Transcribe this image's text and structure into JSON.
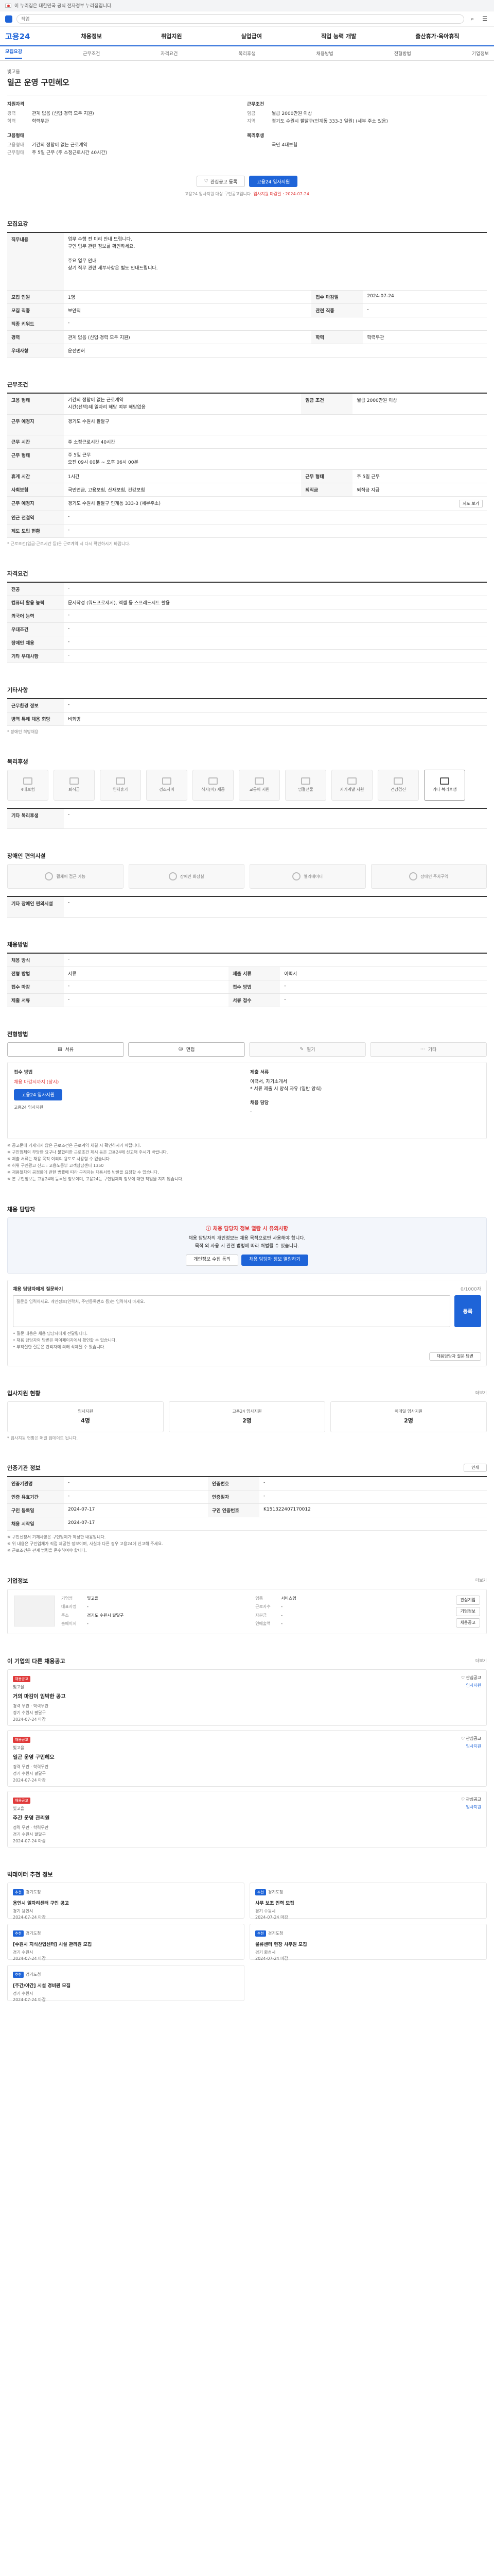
{
  "gov_bar": {
    "text": "이 누리집은 대한민국 공식 전자정부 누리집입니다."
  },
  "top": {
    "search_placeholder": "직업",
    "badge": "신규"
  },
  "header": {
    "logo": "고용24",
    "gnb": [
      "채용정보",
      "취업지원",
      "실업급여",
      "직업 능력 개발",
      "출산휴가·육아휴직"
    ]
  },
  "subtabs": [
    "모집요강",
    "근무조건",
    "자격요건",
    "복리후생",
    "채용방법",
    "전형방법",
    "기업정보"
  ],
  "job": {
    "company_line": "빛고을",
    "title": "일곤 운영 구민헤오"
  },
  "summary": {
    "qual_h": "지원자격",
    "qual": [
      {
        "k": "경력",
        "v": "관계 없음 (신입·경력 모두 지원)"
      },
      {
        "k": "학력",
        "v": "학력무관"
      }
    ],
    "cond_h": "근무조건",
    "cond": [
      {
        "k": "임금",
        "v": "월급 2000만원 이상"
      },
      {
        "k": "지역",
        "v": "경기도 수원시 팔달구(인계동 333-3 일원) (세부 주소 있음)"
      }
    ],
    "form_h": "고용형태",
    "form": [
      {
        "k": "고용형태",
        "v": "기간의 정함이 없는 근로계약"
      },
      {
        "k": "근무형태",
        "v": "주 5일 근무 (주 소정근로시간 40시간)"
      }
    ],
    "welfare_h": "복리후생",
    "welfare": [
      {
        "k": "",
        "v": "국민 4대보험"
      }
    ]
  },
  "apply": {
    "save_label": "관심공고 등록",
    "apply_label": "고용24 입사지원",
    "note": "고용24 입사지원 대상 구인공고입니다.",
    "note_red": "입사지원 마감일 : 2024-07-24"
  },
  "recruit": {
    "title": "모집요강",
    "rows": [
      {
        "k": "직무내용",
        "v": "업무 수행 전 미리 안내 드립니다.\n구인 업무 관련 정보를 확인하세요.\n\n주요 업무 안내\n상기 직무 관련 세부사항은 별도 안내드립니다."
      },
      {
        "k": "모집 인원",
        "v": "1명",
        "k2": "접수 마감일",
        "v2": "2024-07-24"
      },
      {
        "k": "모집 직종",
        "v": "보안직",
        "k2": "관련 직종",
        "v2": "-"
      },
      {
        "k": "직종 키워드",
        "v": "-",
        "k2": "",
        "v2": ""
      },
      {
        "k": "경력",
        "v": "관계 없음 (신입·경력 모두 지원)",
        "k2": "학력",
        "v2": "학력무관"
      },
      {
        "k": "우대사항",
        "v": "운전면허"
      }
    ]
  },
  "work": {
    "title": "근무조건",
    "rows": [
      {
        "k": "고용 형태",
        "v": "기간의 정함이 없는 근로계약\n시간(선택)제 일자리 해당 여부 해당없음",
        "k2": "임금 조건",
        "v2": "월급 2000만원 이상"
      },
      {
        "k": "근무 예정지",
        "v": "경기도 수원시 팔달구",
        "k2": "",
        "v2": ""
      },
      {
        "k": "근무 시간",
        "v": "주 소정근로시간 40시간",
        "k2": "",
        "v2": ""
      },
      {
        "k": "근무 형태",
        "v": "주 5일 근무\n오전 09시 00분 ~ 오후 06시 00분",
        "k2": "",
        "v2": ""
      },
      {
        "k": "휴게 시간",
        "v": "1시간",
        "k2": "근무 형태",
        "v2": "주 5일 근무"
      },
      {
        "k": "사회보험",
        "v": "국민연금, 고용보험, 산재보험, 건강보험",
        "k2": "퇴직금",
        "v2": "퇴직금 지급"
      },
      {
        "k": "근무 예정지",
        "v": "경기도 수원시 팔달구 인계동 333-3 (세부주소)",
        "k2": "",
        "v2": ""
      },
      {
        "k": "인근 전철역",
        "v": "-",
        "k2": "",
        "v2": ""
      },
      {
        "k": "제도 도입 현황",
        "v": "-",
        "k2": "",
        "v2": ""
      }
    ],
    "map_btn": "지도 보기",
    "note": "* 근로조건(임금·근로시간 등)은 근로계약 시 다시 확인하시기 바랍니다."
  },
  "qualify": {
    "title": "자격요건",
    "rows": [
      {
        "k": "전공",
        "v": "-"
      },
      {
        "k": "컴퓨터 활용 능력",
        "v": "문서작성 (워드프로세서), 엑셀 등 스프레드시트 활용"
      },
      {
        "k": "외국어 능력",
        "v": "-"
      },
      {
        "k": "우대조건",
        "v": "-"
      },
      {
        "k": "장애인 채용",
        "v": "-"
      },
      {
        "k": "기타 우대사항",
        "v": "-"
      }
    ]
  },
  "etc": {
    "title": "기타사항",
    "rows": [
      {
        "k": "근무환경 정보",
        "v": "-"
      },
      {
        "k": "병역 특례 채용 희망",
        "v": "비희망"
      }
    ],
    "footnote": "* 장애인 희망채용"
  },
  "welfare": {
    "title": "복리후생",
    "cards": [
      {
        "label": "4대보험",
        "on": false
      },
      {
        "label": "퇴직금",
        "on": false
      },
      {
        "label": "연차휴가",
        "on": false
      },
      {
        "label": "경조사비",
        "on": false
      },
      {
        "label": "식사(비) 제공",
        "on": false
      },
      {
        "label": "교통비 지원",
        "on": false
      },
      {
        "label": "명절선물",
        "on": false
      },
      {
        "label": "자기계발 지원",
        "on": false
      },
      {
        "label": "건강검진",
        "on": false
      },
      {
        "label": "기타 복리후생",
        "on": true
      }
    ],
    "other_k": "기타 복리후생",
    "other_v": "-"
  },
  "disability": {
    "title": "장애인 편의시설",
    "cards": [
      "휠체어 접근 가능",
      "장애인 화장실",
      "엘리베이터",
      "장애인 주차구역"
    ],
    "other_k": "기타 장애인 편의시설",
    "other_v": "-"
  },
  "method": {
    "title": "채용방법",
    "rows": [
      {
        "k": "채용 방식",
        "v": "-"
      },
      {
        "k": "전형 방법",
        "v": "서류",
        "k2": "제출 서류",
        "v2": "이력서"
      },
      {
        "k": "접수 마감",
        "v": "-",
        "k2": "접수 방법",
        "v2": "-"
      },
      {
        "k": "제출 서류",
        "v": "-",
        "k2": "서류 접수",
        "v2": "-"
      }
    ]
  },
  "screening": {
    "title": "전형방법",
    "methods": [
      {
        "label": "서류",
        "on": true
      },
      {
        "label": "면접",
        "on": true
      },
      {
        "label": "필기",
        "on": false
      },
      {
        "label": "기타",
        "on": false
      }
    ],
    "apply_h": "접수 방법",
    "apply_red": "채용 마감시까지 (상시)",
    "apply_btn": "고용24 입사지원",
    "apply_small": "고용24 입사지원",
    "docs_h": "제출 서류",
    "docs_v": "이력서, 자기소개서\n* 서류 제출 시 양식 자유 (일반 양식)",
    "contact_h": "채용 담당",
    "contact_v": "-",
    "notes": [
      "※ 공고문에 기재되지 않은 근로조건은 근로계약 체결 시 확인하시기 바랍니다.",
      "※ 구인업체의 부당한 요구나 불합리한 근로조건 제시 등은 고용24에 신고해 주시기 바랍니다.",
      "※ 제출 서류는 채용 목적 이외의 용도로 사용할 수 없습니다.",
      "※ 허위 구인광고 신고 : 고용노동부 고객상담센터 1350",
      "※ 채용절차의 공정화에 관한 법률에 따라 구직자는 채용서류 반환을 요청할 수 있습니다.",
      "※ 본 구인정보는 고용24에 등록된 정보이며, 고용24는 구인업체의 정보에 대한 책임을 지지 않습니다."
    ]
  },
  "contact": {
    "title": "채용 담당자",
    "warn_title": "채용 담당자 정보 열람 시 유의사항",
    "warn_lines": [
      "채용 담당자의 개인정보는 채용 목적으로만 사용해야 합니다.",
      "목적 외 사용 시 관련 법령에 따라 처벌될 수 있습니다."
    ],
    "btn_a": "개인정보 수집 동의",
    "btn_b": "채용 담당자 정보 열람하기"
  },
  "qa": {
    "title": "채용 담당자에게 질문하기",
    "counter": "0/1000자",
    "placeholder": "질문을 입력하세요. 개인정보(연락처, 주민등록번호 등)는 입력하지 마세요.",
    "send": "등록",
    "list": [
      "• 질문 내용은 채용 담당자에게 전달됩니다.",
      "• 채용 담당자의 답변은 마이페이지에서 확인할 수 있습니다.",
      "• 부적절한 질문은 관리자에 의해 삭제될 수 있습니다."
    ],
    "more_btn": "채용담당자 질문 답변"
  },
  "status": {
    "title": "입사지원 현황",
    "more": "더보기",
    "stats": [
      {
        "label": "입사지원",
        "num": "4명"
      },
      {
        "label": "고용24 입사지원",
        "num": "2명"
      },
      {
        "label": "이메일 입사지원",
        "num": "2명"
      }
    ],
    "note": "* 입사지원 현황은 매일 업데이트 됩니다."
  },
  "info": {
    "title": "인증기관 정보",
    "print": "인쇄",
    "rows": [
      {
        "k": "인증기관명",
        "v": "-",
        "k2": "인증번호",
        "v2": "-"
      },
      {
        "k": "인증 유효기간",
        "v": "-",
        "k2": "인증일자",
        "v2": "-"
      },
      {
        "k": "구인 등록일",
        "v": "2024-07-17",
        "k2": "구인 인증번호",
        "v2": "K151322407170012"
      },
      {
        "k": "채용 시작일",
        "v": "2024-07-17",
        "k2": "",
        "v2": ""
      }
    ],
    "notes": [
      "※ 구인신청서 기재사항은 구인업체가 작성한 내용입니다.",
      "※ 위 내용은 구인업체가 직접 제공한 정보이며, 사실과 다른 경우 고용24에 신고해 주세요.",
      "※ 근로조건은 관계 법령을 준수하여야 합니다."
    ]
  },
  "company": {
    "title": "기업정보",
    "more": "더보기",
    "fields": [
      {
        "k": "기업명",
        "v": "빛고을"
      },
      {
        "k": "업종",
        "v": "서비스업"
      },
      {
        "k": "대표자명",
        "v": "-"
      },
      {
        "k": "근로자수",
        "v": "-"
      },
      {
        "k": "주소",
        "v": "경기도 수원시 팔달구"
      },
      {
        "k": "자본금",
        "v": "-"
      },
      {
        "k": "홈페이지",
        "v": "-"
      },
      {
        "k": "연매출액",
        "v": "-"
      }
    ],
    "btns": [
      "관심기업",
      "기업정보",
      "채용공고"
    ]
  },
  "others": {
    "title": "이 기업의 다른 채용공고",
    "more": "더보기",
    "items": [
      {
        "tag": "채용공고",
        "org": "빛고을",
        "title": "거의 마감이 임박한 공고",
        "meta": "경력 무관 · 학력무관\n경기 수원시 팔달구\n2024-07-24 마감"
      },
      {
        "tag": "채용공고",
        "org": "빛고을",
        "title": "일곤 운영 구민헤오",
        "meta": "경력 무관 · 학력무관\n경기 수원시 팔달구\n2024-07-24 마감"
      },
      {
        "tag": "채용공고",
        "org": "빛고을",
        "title": "주간 운영 관리원",
        "meta": "경력 무관 · 학력무관\n경기 수원시 팔달구\n2024-07-24 마감"
      }
    ],
    "side": [
      "관심공고",
      "입사지원"
    ]
  },
  "recommend": {
    "title": "빅데이터 추천 정보",
    "cards": [
      {
        "tag": "추천",
        "org": "경기도청",
        "title": "용인시 일자리센터 구인 공고",
        "meta": "경기 용인시\n2024-07-24 마감"
      },
      {
        "tag": "추천",
        "org": "경기도청",
        "title": "사무 보조 인력 모집",
        "meta": "경기 수원시\n2024-07-24 마감"
      },
      {
        "tag": "추천",
        "org": "경기도청",
        "title": "[수원시 지식산업센터] 시설 관리원 모집",
        "meta": "경기 수원시\n2024-07-24 마감"
      },
      {
        "tag": "추천",
        "org": "경기도청",
        "title": "물류센터 현장 사무원 모집",
        "meta": "경기 화성시\n2024-07-24 마감"
      },
      {
        "tag": "추천",
        "org": "경기도청",
        "title": "[주간/야간] 시설 경비원 모집",
        "meta": "경기 수원시\n2024-07-24 마감"
      }
    ]
  }
}
